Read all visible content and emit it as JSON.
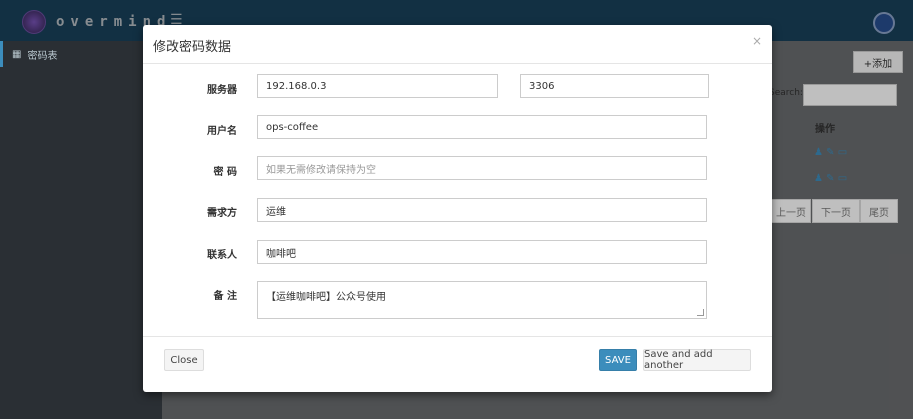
{
  "topbar": {
    "logo_text": "overmind",
    "menu_icon": "hamburger-icon",
    "user_icon": "avatar-icon"
  },
  "sidebar": {
    "items": [
      {
        "label": "密码表",
        "icon": "table-icon"
      }
    ]
  },
  "background": {
    "add_button": "+添加",
    "search_label": "Search:",
    "column_header": "操作",
    "pagination": [
      "上一页",
      "下一页",
      "尾页"
    ]
  },
  "modal": {
    "title": "修改密码数据",
    "close_glyph": "×",
    "fields": {
      "server": {
        "label": "服务器",
        "value": "192.168.0.3",
        "port_value": "3306"
      },
      "username": {
        "label": "用户名",
        "value": "ops-coffee"
      },
      "password": {
        "label": "密 码",
        "placeholder": "如果无需修改请保持为空"
      },
      "requester": {
        "label": "需求方",
        "value": "运维"
      },
      "contact": {
        "label": "联系人",
        "value": "咖啡吧"
      },
      "note": {
        "label": "备 注",
        "value": "【运维咖啡吧】公众号使用"
      }
    },
    "buttons": {
      "close": "Close",
      "save": "SAVE",
      "save_add": "Save and add another"
    }
  },
  "colors": {
    "topbar": "#1d4b68",
    "sidebar": "#2a2f34",
    "primary": "#3c8dbc"
  }
}
